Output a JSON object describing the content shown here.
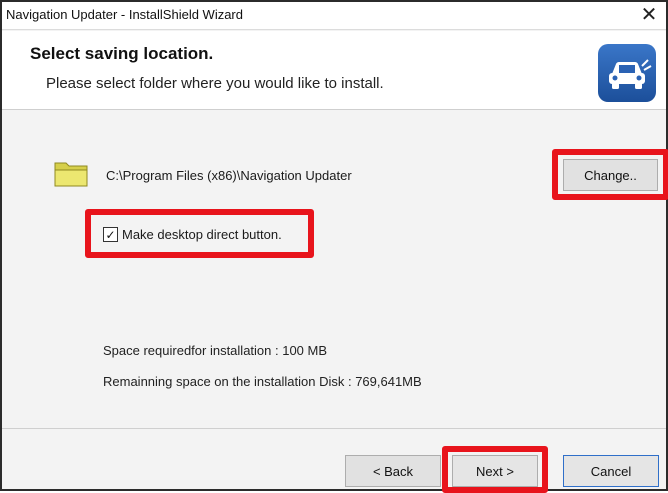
{
  "window": {
    "title": "Navigation Updater - InstallShield Wizard",
    "close_glyph": "✕"
  },
  "header": {
    "title": "Select saving location.",
    "subtitle": "Please select folder where you would like to install.",
    "icon": "navigation-car-icon"
  },
  "location": {
    "folder_icon": "folder-icon",
    "path": "C:\\Program Files (x86)\\Navigation Updater",
    "change_label": "Change.."
  },
  "shortcut": {
    "checked": true,
    "check_glyph": "✓",
    "label": "Make desktop direct button."
  },
  "info": {
    "space_required": "Space requiredfor installation : 100 MB",
    "space_remaining": "Remainning space on the installation Disk :   769,641MB"
  },
  "footer": {
    "back_label": "< Back",
    "next_label": "Next >",
    "cancel_label": "Cancel"
  },
  "colors": {
    "highlight": "#e8141c",
    "icon_blue": "#2a62b4",
    "folder_yellow": "#e7e26a"
  }
}
